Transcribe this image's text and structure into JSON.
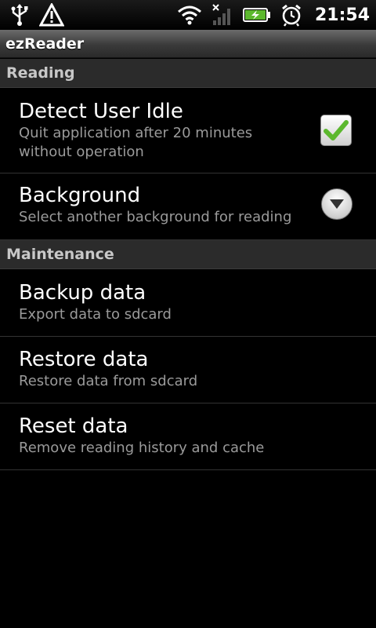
{
  "status_bar": {
    "time": "21:54",
    "icons": [
      "usb-icon",
      "warning-icon",
      "wifi-icon",
      "signal-icon",
      "battery-charging-icon",
      "alarm-clock-icon"
    ]
  },
  "app": {
    "title": "ezReader"
  },
  "sections": {
    "reading": {
      "header": "Reading",
      "detect_idle": {
        "title": "Detect User Idle",
        "summary_line1": "Quit application after 20 minutes",
        "summary_line2": "without operation",
        "checked": true
      },
      "background": {
        "title": "Background",
        "summary": "Select another background for reading"
      }
    },
    "maintenance": {
      "header": "Maintenance",
      "backup": {
        "title": "Backup data",
        "summary": "Export data to sdcard"
      },
      "restore": {
        "title": "Restore data",
        "summary": "Restore data from sdcard"
      },
      "reset": {
        "title": "Reset data",
        "summary": "Remove reading history and cache"
      }
    }
  },
  "colors": {
    "accent_check": "#5cb82e",
    "summary_text": "#9a9a9a",
    "section_header_bg": "#2b2b2b"
  }
}
